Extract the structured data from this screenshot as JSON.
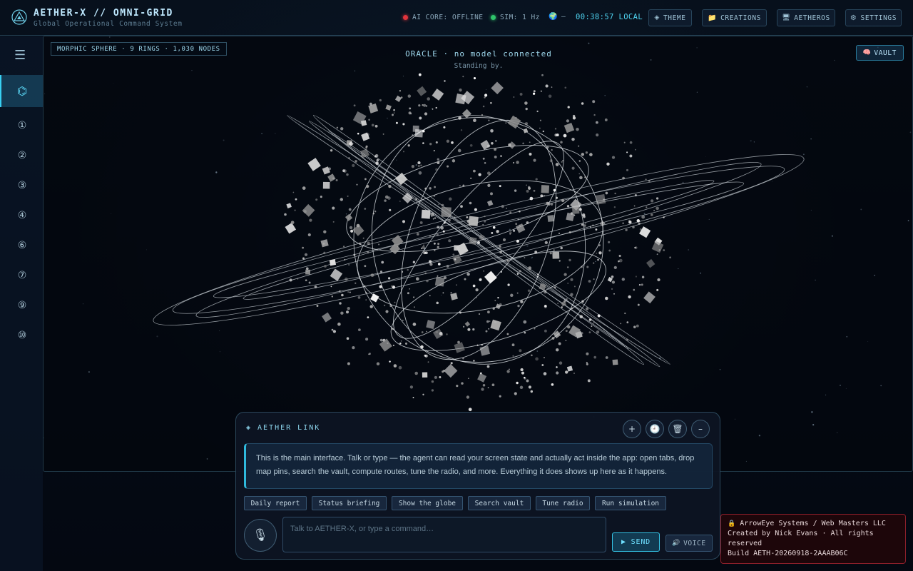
{
  "header": {
    "title": "AETHER-X // OMNI-GRID",
    "subtitle": "Global Operational Command System",
    "logo_icon": "triangle-logo-icon",
    "status": {
      "ai_core": "AI CORE: OFFLINE",
      "ai_core_color": "#e0343c",
      "sim": "SIM: 1 Hz",
      "sim_color": "#2fc46a",
      "geo_icon": "🌍",
      "geo": "—",
      "clock": "00:38:57 LOCAL"
    },
    "buttons": {
      "theme": "THEME",
      "theme_icon": "◈",
      "creations": "CREATIONS",
      "creations_icon": "📁",
      "aetheros": "AETHEROS",
      "aetheros_icon": "🖥",
      "settings": "SETTINGS",
      "settings_icon": "⚙"
    }
  },
  "sidebar": {
    "menu_icon": "☰",
    "active_icon": "⌬",
    "items": [
      "①",
      "②",
      "③",
      "④",
      "⑥",
      "⑦",
      "⑨",
      "⑩"
    ]
  },
  "viewport": {
    "sphere_tag": "MORPHIC SPHERE · 9 RINGS · 1,030 NODES",
    "oracle": "ORACLE · no model connected",
    "standing": "Standing by.",
    "vault_icon": "🧠",
    "vault": "VAULT"
  },
  "chat": {
    "title": "◈ AETHER LINK",
    "icons": {
      "add": "+",
      "history": "🕘",
      "delete": "🗑",
      "minimize": "–"
    },
    "message": "This is the main interface. Talk or type — the agent can read your screen state and actually act inside the app: open tabs, drop map pins, search the vault, compute routes, tune the radio, and more. Everything it does shows up here as it happens.",
    "chips": [
      "Daily report",
      "Status briefing",
      "Show the globe",
      "Search vault",
      "Tune radio",
      "Run simulation"
    ],
    "mic_icon": "🎙",
    "placeholder": "Talk to AETHER-X, or type a command…",
    "send": "▶ SEND",
    "voice_icon": "🔊",
    "voice": "VOICE"
  },
  "footer": {
    "lock_icon": "🔒",
    "line1": "ArrowEye Systems / Web Masters LLC",
    "line2": "Created by Nick Evans · All rights reserved",
    "line3": "Build AETH-20260918-2AAAB06C"
  },
  "colors": {
    "accent": "#38d0f2",
    "background": "#050a14",
    "danger_border": "#8b1f2a"
  }
}
